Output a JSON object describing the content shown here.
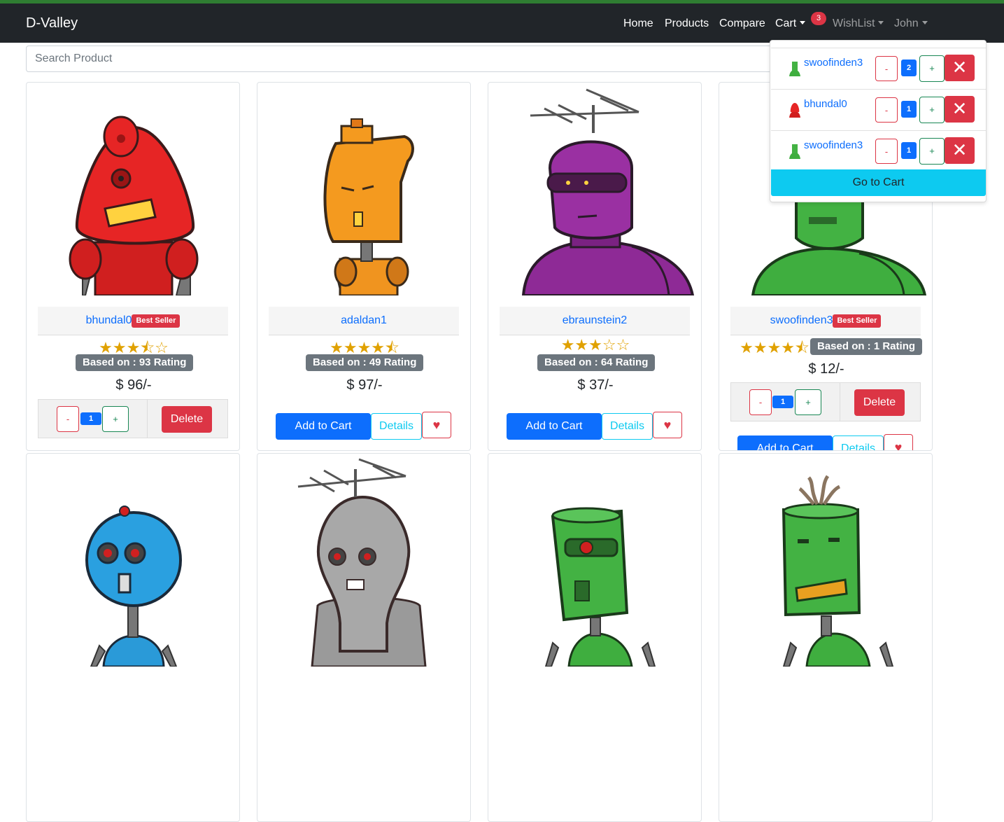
{
  "nav": {
    "brand": "D-Valley",
    "links": [
      "Home",
      "Products",
      "Compare",
      "Cart"
    ],
    "cart_count": "3",
    "wishlist": "WishList",
    "user": "John"
  },
  "search": {
    "placeholder": "Search Product"
  },
  "colors": {
    "primary": "#0d6efd",
    "danger": "#dc3545",
    "info": "#0dcaf0",
    "success": "#198754",
    "nav_bg": "#212529",
    "star": "#e0a100"
  },
  "cart_dropdown": {
    "items": [
      {
        "name": "swoofinden3",
        "minus": "-",
        "qty": "2",
        "plus": "+",
        "remove": "✕"
      },
      {
        "name": "bhundal0",
        "minus": "-",
        "qty": "1",
        "plus": "+",
        "remove": "✕"
      },
      {
        "name": "swoofinden3",
        "minus": "-",
        "qty": "1",
        "plus": "+",
        "remove": "✕"
      }
    ],
    "go_to_cart": "Go to Cart"
  },
  "products": [
    {
      "name": "bhundal0",
      "badge": "Best Seller",
      "stars": "★★★⯪☆",
      "rating_text": "Based on : 93 Rating",
      "price": "$ 96/-",
      "qty": "1",
      "minus": "-",
      "plus": "+",
      "delete": "Delete"
    },
    {
      "name": "adaldan1",
      "stars": "★★★★⯪",
      "rating_text": "Based on : 49 Rating",
      "price": "$ 97/-",
      "add_to_cart": "Add to Cart",
      "details": "Details",
      "heart": "♥"
    },
    {
      "name": "ebraunstein2",
      "stars": "★★★☆☆",
      "rating_text": "Based on : 64 Rating",
      "price": "$ 37/-",
      "add_to_cart": "Add to Cart",
      "details": "Details",
      "heart": "♥"
    },
    {
      "name": "swoofinden3",
      "badge": "Best Seller",
      "stars": "★★★★⯪",
      "rating_text": "Based on : 1 Rating",
      "price": "$ 12/-",
      "qty": "1",
      "minus": "-",
      "plus": "+",
      "delete": "Delete",
      "add_to_cart": "Add to Cart",
      "details": "Details",
      "heart": "♥"
    }
  ]
}
